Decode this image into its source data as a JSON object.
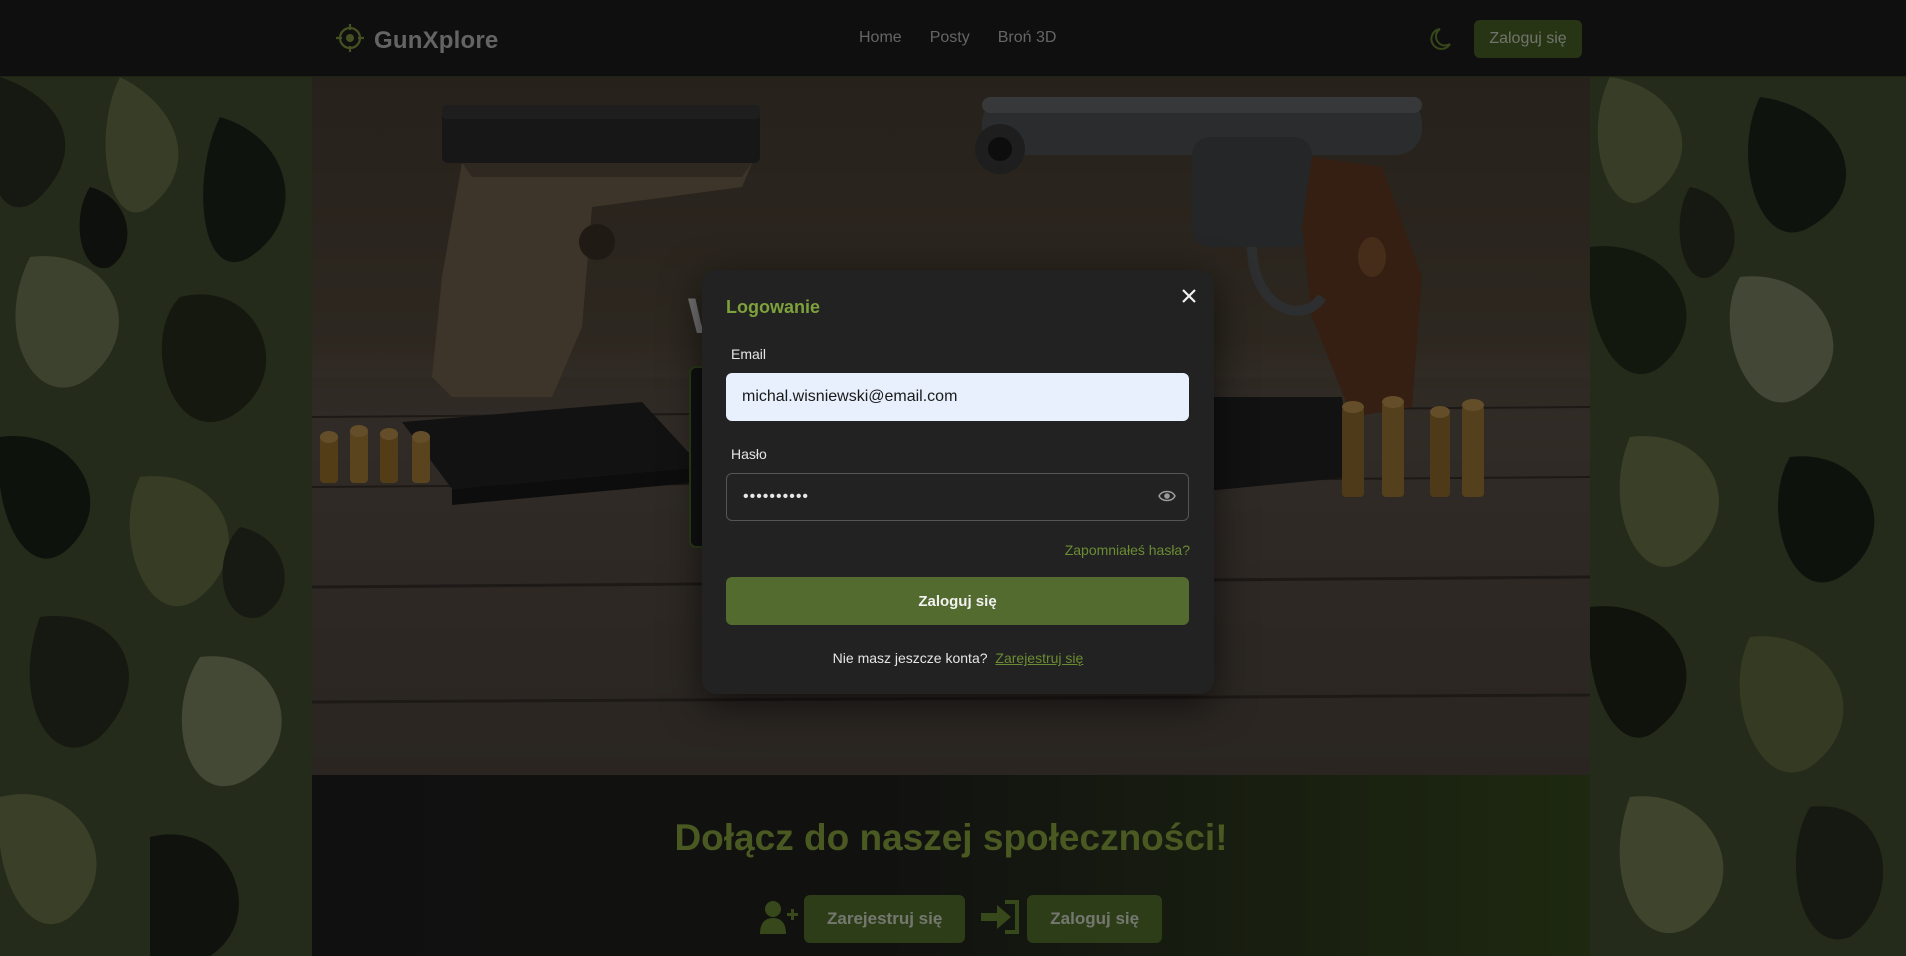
{
  "nav": {
    "brand": "GunXplore",
    "links": [
      "Home",
      "Posty",
      "Broń 3D"
    ],
    "login_button": "Zaloguj się"
  },
  "hero": {
    "image": "pistol-revolver-ammo-table-photo",
    "partial_heading_char": "W"
  },
  "community": {
    "title": "Dołącz do naszej społeczności!",
    "register_button": "Zarejestruj się",
    "login_button": "Zaloguj się"
  },
  "modal": {
    "title": "Logowanie",
    "email_label": "Email",
    "email_value": "michal.wisniewski@email.com",
    "password_label": "Hasło",
    "password_value": "••••••••••",
    "forgot_password": "Zapomniałeś hasła?",
    "submit_button": "Zaloguj się",
    "register_prompt": "Nie masz jeszcze konta?",
    "register_link": "Zarejestruj się"
  },
  "colors": {
    "accent_green": "#536b2f",
    "title_green": "#7fa13d",
    "link_green": "#6c8c34",
    "navbar_bg": "#1e1f1e",
    "modal_bg": "#212221"
  }
}
